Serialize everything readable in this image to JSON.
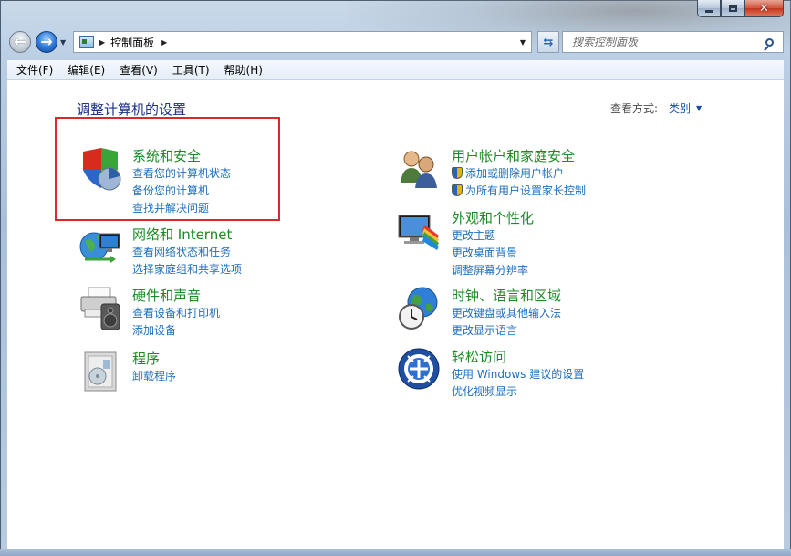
{
  "nav": {
    "address_path": "控制面板",
    "search_placeholder": "搜索控制面板"
  },
  "menu": [
    "文件(F)",
    "编辑(E)",
    "查看(V)",
    "工具(T)",
    "帮助(H)"
  ],
  "main": {
    "page_title": "调整计算机的设置",
    "view_by_label": "查看方式:",
    "view_by_value": "类别"
  },
  "categories": [
    {
      "title": "系统和安全",
      "icon": "shield-pie-icon",
      "links": [
        "查看您的计算机状态",
        "备份您的计算机",
        "查找并解决问题"
      ]
    },
    {
      "title": "网络和 Internet",
      "icon": "network-globe-icon",
      "links": [
        "查看网络状态和任务",
        "选择家庭组和共享选项"
      ]
    },
    {
      "title": "硬件和声音",
      "icon": "printer-speaker-icon",
      "links": [
        "查看设备和打印机",
        "添加设备"
      ]
    },
    {
      "title": "程序",
      "icon": "programs-box-icon",
      "links": [
        "卸载程序"
      ]
    },
    {
      "title": "用户帐户和家庭安全",
      "icon": "users-icon",
      "links": [
        "添加或删除用户帐户",
        "为所有用户设置家长控制"
      ]
    },
    {
      "title": "外观和个性化",
      "icon": "monitor-palette-icon",
      "links": [
        "更改主题",
        "更改桌面背景",
        "调整屏幕分辨率"
      ]
    },
    {
      "title": "时钟、语言和区域",
      "icon": "globe-clock-icon",
      "links": [
        "更改键盘或其他输入法",
        "更改显示语言"
      ]
    },
    {
      "title": "轻松访问",
      "icon": "ease-of-access-icon",
      "links": [
        "使用 Windows 建议的设置",
        "优化视频显示"
      ]
    }
  ],
  "colors": {
    "category_title": "#1c8a26",
    "link": "#1e6fbf",
    "highlight_box": "#e0262d"
  }
}
